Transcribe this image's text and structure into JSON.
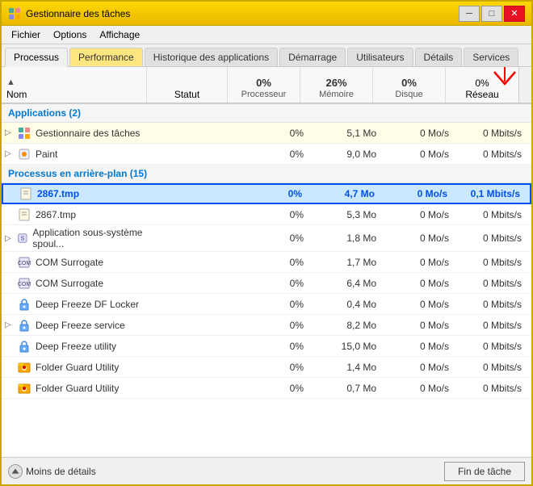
{
  "window": {
    "title": "Gestionnaire des tâches",
    "icon": "🖥"
  },
  "window_controls": {
    "minimize": "─",
    "restore": "□",
    "close": "✕"
  },
  "menu": {
    "items": [
      "Fichier",
      "Options",
      "Affichage"
    ]
  },
  "tabs": [
    {
      "label": "Processus",
      "active": true
    },
    {
      "label": "Performance",
      "active": false,
      "highlight": true
    },
    {
      "label": "Historique des applications",
      "active": false
    },
    {
      "label": "Démarrage",
      "active": false
    },
    {
      "label": "Utilisateurs",
      "active": false
    },
    {
      "label": "Détails",
      "active": false
    },
    {
      "label": "Services",
      "active": false
    }
  ],
  "columns": {
    "name": "Nom",
    "status": "Statut",
    "cpu": {
      "value": "0%",
      "label": "Processeur"
    },
    "memory": {
      "value": "26%",
      "label": "Mémoire"
    },
    "disk": {
      "value": "0%",
      "label": "Disque"
    },
    "network": {
      "value": "0%",
      "label": "Réseau"
    }
  },
  "sections": [
    {
      "title": "Applications (2)",
      "rows": [
        {
          "name": "Gestionnaire des tâches",
          "status": "",
          "cpu": "0%",
          "memory": "5,1 Mo",
          "disk": "0 Mo/s",
          "network": "0 Mbits/s",
          "expandable": true,
          "icon": "app"
        },
        {
          "name": "Paint",
          "status": "",
          "cpu": "0%",
          "memory": "9,0 Mo",
          "disk": "0 Mo/s",
          "network": "0 Mbits/s",
          "expandable": true,
          "icon": "paint"
        }
      ]
    },
    {
      "title": "Processus en arrière-plan (15)",
      "rows": [
        {
          "name": "2867.tmp",
          "status": "",
          "cpu": "0%",
          "memory": "4,7 Mo",
          "disk": "0 Mo/s",
          "network": "0,1 Mbits/s",
          "selected": true,
          "icon": "tmp"
        },
        {
          "name": "2867.tmp",
          "status": "",
          "cpu": "0%",
          "memory": "5,3 Mo",
          "disk": "0 Mo/s",
          "network": "0 Mbits/s",
          "icon": "tmp"
        },
        {
          "name": "Application sous-système spoul...",
          "status": "",
          "cpu": "0%",
          "memory": "1,8 Mo",
          "disk": "0 Mo/s",
          "network": "0 Mbits/s",
          "expandable": true,
          "icon": "sys"
        },
        {
          "name": "COM Surrogate",
          "status": "",
          "cpu": "0%",
          "memory": "1,7 Mo",
          "disk": "0 Mo/s",
          "network": "0 Mbits/s",
          "icon": "com"
        },
        {
          "name": "COM Surrogate",
          "status": "",
          "cpu": "0%",
          "memory": "6,4 Mo",
          "disk": "0 Mo/s",
          "network": "0 Mbits/s",
          "icon": "com"
        },
        {
          "name": "Deep Freeze DF Locker",
          "status": "",
          "cpu": "0%",
          "memory": "0,4 Mo",
          "disk": "0 Mo/s",
          "network": "0 Mbits/s",
          "icon": "df"
        },
        {
          "name": "Deep Freeze service",
          "status": "",
          "cpu": "0%",
          "memory": "8,2 Mo",
          "disk": "0 Mo/s",
          "network": "0 Mbits/s",
          "expandable": true,
          "icon": "df"
        },
        {
          "name": "Deep Freeze utility",
          "status": "",
          "cpu": "0%",
          "memory": "15,0 Mo",
          "disk": "0 Mo/s",
          "network": "0 Mbits/s",
          "icon": "df"
        },
        {
          "name": "Folder Guard Utility",
          "status": "",
          "cpu": "0%",
          "memory": "1,4 Mo",
          "disk": "0 Mo/s",
          "network": "0 Mbits/s",
          "icon": "fg"
        },
        {
          "name": "Folder Guard Utility",
          "status": "",
          "cpu": "0%",
          "memory": "0,7 Mo",
          "disk": "0 Mo/s",
          "network": "0 Mbits/s",
          "icon": "fg"
        }
      ]
    }
  ],
  "status_bar": {
    "less_detail": "Moins de détails",
    "end_task": "Fin de tâche"
  }
}
